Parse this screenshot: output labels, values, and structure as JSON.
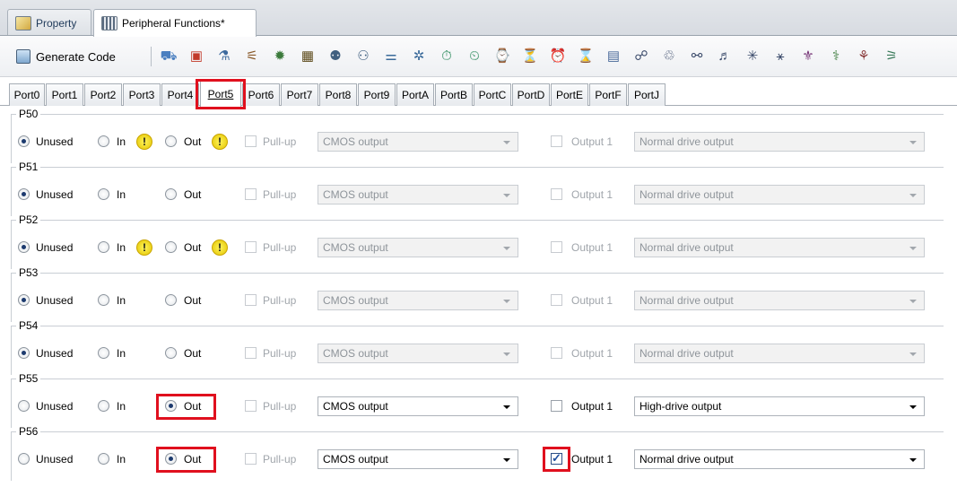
{
  "doc_tabs": [
    {
      "label": "Property",
      "active": false
    },
    {
      "label": "Peripheral Functions*",
      "active": true
    }
  ],
  "toolbar": {
    "generate_label": "Generate Code",
    "icons": [
      "cgc-icon",
      "voltage-detect-icon",
      "clock-icon",
      "interrupt-icon",
      "dtc-icon",
      "chip-icon",
      "port-icon",
      "port-b-icon",
      "io-icon",
      "pin-icon",
      "timer-icon",
      "timer-b-icon",
      "timer-c-icon",
      "timer-d-icon",
      "timer-e-icon",
      "timer-f-icon",
      "rtc-icon",
      "wdt-icon",
      "sci-icon",
      "sci-b-icon",
      "i2c-icon",
      "spi-icon",
      "i2c-b-icon",
      "adc-icon",
      "dac-icon",
      "crc-icon",
      "dsp-icon"
    ]
  },
  "port_tabs": [
    "Port0",
    "Port1",
    "Port2",
    "Port3",
    "Port4",
    "Port5",
    "Port6",
    "Port7",
    "Port8",
    "Port9",
    "PortA",
    "PortB",
    "PortC",
    "PortD",
    "PortE",
    "PortF",
    "PortJ"
  ],
  "active_port": "Port5",
  "labels": {
    "unused": "Unused",
    "in": "In",
    "out": "Out",
    "pullup": "Pull-up",
    "output1": "Output 1",
    "warn_symbol": "!"
  },
  "pins": [
    {
      "name": "P50",
      "mode": "Unused",
      "warn": true,
      "output_type": "CMOS output",
      "output1": false,
      "drive": "Normal drive output",
      "enabled": false
    },
    {
      "name": "P51",
      "mode": "Unused",
      "warn": false,
      "output_type": "CMOS output",
      "output1": false,
      "drive": "Normal drive output",
      "enabled": false
    },
    {
      "name": "P52",
      "mode": "Unused",
      "warn": true,
      "output_type": "CMOS output",
      "output1": false,
      "drive": "Normal drive output",
      "enabled": false
    },
    {
      "name": "P53",
      "mode": "Unused",
      "warn": false,
      "output_type": "CMOS output",
      "output1": false,
      "drive": "Normal drive output",
      "enabled": false
    },
    {
      "name": "P54",
      "mode": "Unused",
      "warn": false,
      "output_type": "CMOS output",
      "output1": false,
      "drive": "Normal drive output",
      "enabled": false
    },
    {
      "name": "P55",
      "mode": "Out",
      "warn": false,
      "output_type": "CMOS output",
      "output1": false,
      "drive": "High-drive output",
      "enabled": true,
      "highlight_out": true
    },
    {
      "name": "P56",
      "mode": "Out",
      "warn": false,
      "output_type": "CMOS output",
      "output1": true,
      "drive": "Normal drive output",
      "enabled": true,
      "highlight_out": true,
      "highlight_output1": true
    }
  ],
  "colors": {
    "highlight": "#e0101e",
    "warn": "#f3d81a"
  }
}
